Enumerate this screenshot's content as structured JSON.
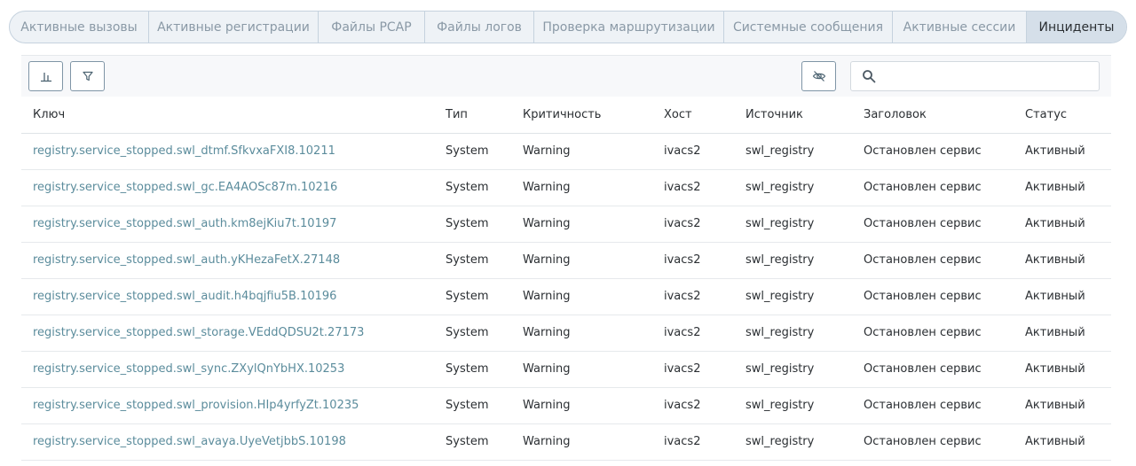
{
  "tabs": [
    {
      "label": "Активные вызовы",
      "active": false
    },
    {
      "label": "Активные регистрации",
      "active": false
    },
    {
      "label": "Файлы PCAP",
      "active": false
    },
    {
      "label": "Файлы логов",
      "active": false
    },
    {
      "label": "Проверка маршрутизации",
      "active": false
    },
    {
      "label": "Системные сообщения",
      "active": false
    },
    {
      "label": "Активные сессии",
      "active": false
    },
    {
      "label": "Инциденты",
      "active": true
    }
  ],
  "toolbar": {
    "chart_icon": "bar-chart-icon",
    "filter_icon": "filter-icon",
    "hide_icon": "eye-off-icon",
    "search_icon": "search-icon",
    "search_value": "",
    "search_placeholder": ""
  },
  "table": {
    "columns": [
      "Ключ",
      "Тип",
      "Критичность",
      "Хост",
      "Источник",
      "Заголовок",
      "Статус"
    ],
    "rows": [
      [
        "registry.service_stopped.swl_dtmf.SfkvxaFXI8.10211",
        "System",
        "Warning",
        "ivacs2",
        "swl_registry",
        "Остановлен сервис",
        "Активный"
      ],
      [
        "registry.service_stopped.swl_gc.EA4AOSc87m.10216",
        "System",
        "Warning",
        "ivacs2",
        "swl_registry",
        "Остановлен сервис",
        "Активный"
      ],
      [
        "registry.service_stopped.swl_auth.km8ejKiu7t.10197",
        "System",
        "Warning",
        "ivacs2",
        "swl_registry",
        "Остановлен сервис",
        "Активный"
      ],
      [
        "registry.service_stopped.swl_auth.yKHezaFetX.27148",
        "System",
        "Warning",
        "ivacs2",
        "swl_registry",
        "Остановлен сервис",
        "Активный"
      ],
      [
        "registry.service_stopped.swl_audit.h4bqjfiu5B.10196",
        "System",
        "Warning",
        "ivacs2",
        "swl_registry",
        "Остановлен сервис",
        "Активный"
      ],
      [
        "registry.service_stopped.swl_storage.VEddQDSU2t.27173",
        "System",
        "Warning",
        "ivacs2",
        "swl_registry",
        "Остановлен сервис",
        "Активный"
      ],
      [
        "registry.service_stopped.swl_sync.ZXylQnYbHX.10253",
        "System",
        "Warning",
        "ivacs2",
        "swl_registry",
        "Остановлен сервис",
        "Активный"
      ],
      [
        "registry.service_stopped.swl_provision.HIp4yrfyZt.10235",
        "System",
        "Warning",
        "ivacs2",
        "swl_registry",
        "Остановлен сервис",
        "Активный"
      ],
      [
        "registry.service_stopped.swl_avaya.UyeVetjbbS.10198",
        "System",
        "Warning",
        "ivacs2",
        "swl_registry",
        "Остановлен сервис",
        "Активный"
      ]
    ]
  },
  "colors": {
    "link": "#5b8c9c",
    "tab_active_bg": "#d5dfe9",
    "tab_text": "#8a99a6"
  }
}
